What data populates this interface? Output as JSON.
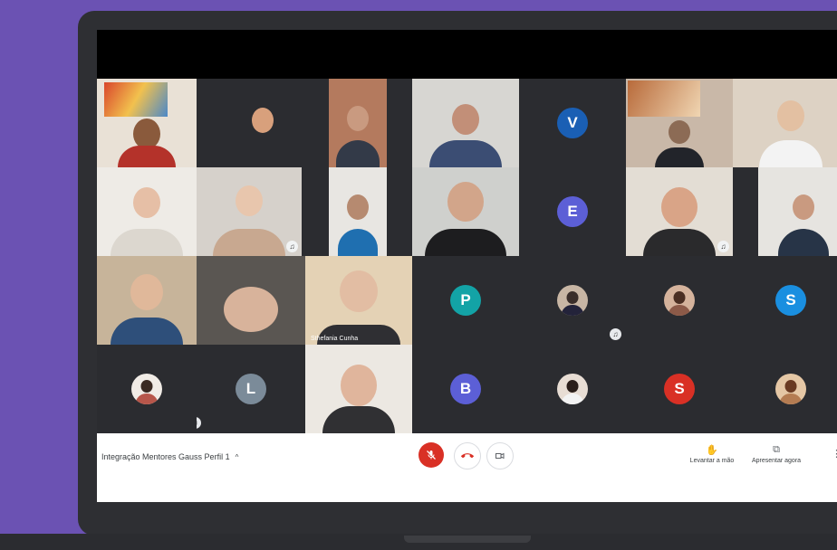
{
  "meeting": {
    "title": "Integração Mentores Gauss Perfil 1",
    "chevron": "^"
  },
  "controls": {
    "mic_icon": "mic-off-icon",
    "hangup_icon": "call-end-icon",
    "camera_icon": "videocam-icon"
  },
  "actions": {
    "raise_hand": {
      "label": "Levantar a mão",
      "icon": "hand-icon"
    },
    "present": {
      "label": "Apresentar agora",
      "icon": "present-icon"
    }
  },
  "participants": [
    {
      "type": "video"
    },
    {
      "type": "video"
    },
    {
      "type": "video"
    },
    {
      "type": "video"
    },
    {
      "type": "avatar",
      "initial": "V"
    },
    {
      "type": "video"
    },
    {
      "type": "video"
    },
    {
      "type": "video"
    },
    {
      "type": "video"
    },
    {
      "type": "video"
    },
    {
      "type": "video"
    },
    {
      "type": "avatar",
      "initial": "E"
    },
    {
      "type": "video"
    },
    {
      "type": "video"
    },
    {
      "type": "video"
    },
    {
      "type": "video"
    },
    {
      "type": "video",
      "name": "Sthefania Cunha"
    },
    {
      "type": "avatar",
      "initial": "P"
    },
    {
      "type": "photo"
    },
    {
      "type": "photo"
    },
    {
      "type": "avatar",
      "initial": "S"
    },
    {
      "type": "photo"
    },
    {
      "type": "avatar",
      "initial": "L"
    },
    {
      "type": "video"
    },
    {
      "type": "avatar",
      "initial": "B"
    },
    {
      "type": "photo"
    },
    {
      "type": "avatar",
      "initial": "S"
    },
    {
      "type": "photo"
    }
  ],
  "colors": {
    "background": "#6b52b3",
    "meet_dark": "#202124",
    "mic_off": "#d93025"
  }
}
